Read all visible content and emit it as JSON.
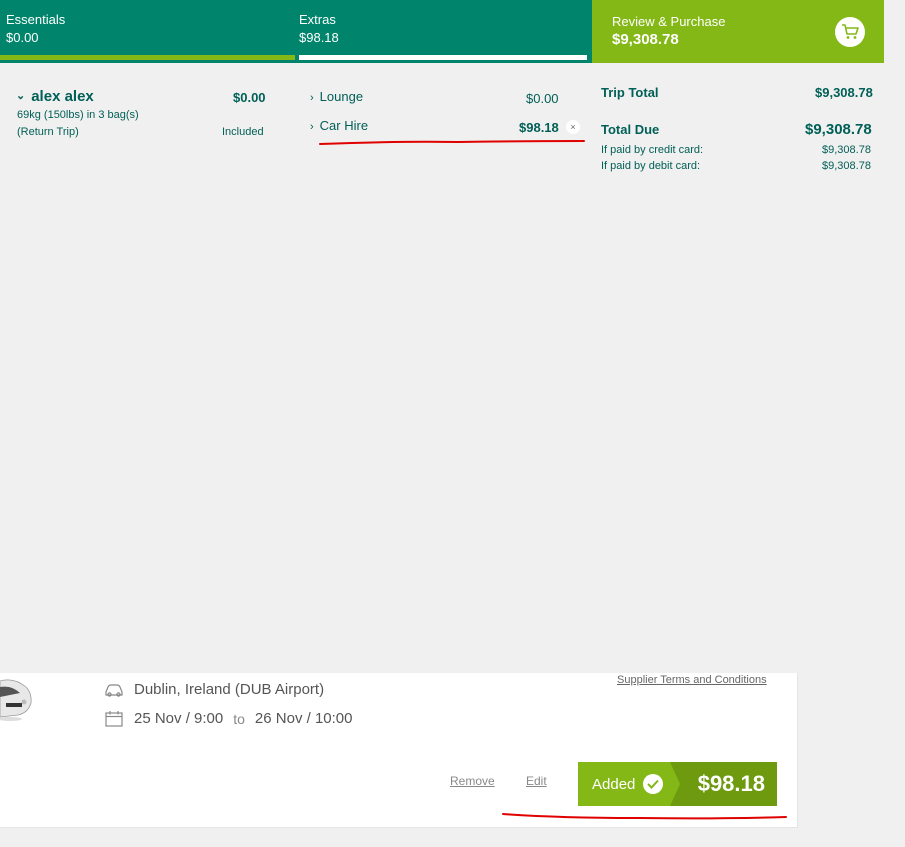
{
  "steps": {
    "essentials": {
      "label": "Essentials",
      "amount": "$0.00"
    },
    "extras": {
      "label": "Extras",
      "amount": "$98.18"
    },
    "review": {
      "label": "Review & Purchase",
      "amount": "$9,308.78"
    }
  },
  "passenger": {
    "name": "alex alex",
    "price": "$0.00",
    "bags": "69kg (150lbs) in 3 bag(s)",
    "trip": "(Return Trip)",
    "included": "Included"
  },
  "extras": {
    "lounge": {
      "label": "Lounge",
      "price": "$0.00"
    },
    "car_hire": {
      "label": "Car Hire",
      "price": "$98.18",
      "remove_symbol": "×"
    }
  },
  "totals": {
    "trip_total_label": "Trip Total",
    "trip_total": "$9,308.78",
    "total_due_label": "Total Due",
    "total_due": "$9,308.78",
    "credit_label": "If paid by credit card:",
    "credit_value": "$9,308.78",
    "debit_label": "If paid by debit card:",
    "debit_value": "$9,308.78"
  },
  "car_card": {
    "location": "Dublin, Ireland (DUB Airport)",
    "pickup": "25 Nov / 9:00",
    "to": "to",
    "dropoff": "26 Nov / 10:00",
    "supplier_link": "Supplier Terms and Conditions",
    "remove_link": "Remove",
    "edit_link": "Edit",
    "added_label": "Added",
    "added_price": "$98.18"
  },
  "colors": {
    "teal": "#00846b",
    "green": "#84b816",
    "dark_green": "#6e9a0f",
    "text_teal": "#005f56",
    "annotation_red": "#e00000"
  },
  "icons": [
    "cart-icon",
    "chevron-down-icon",
    "chevron-right-icon",
    "close-icon",
    "car-icon",
    "calendar-icon",
    "check-icon"
  ]
}
